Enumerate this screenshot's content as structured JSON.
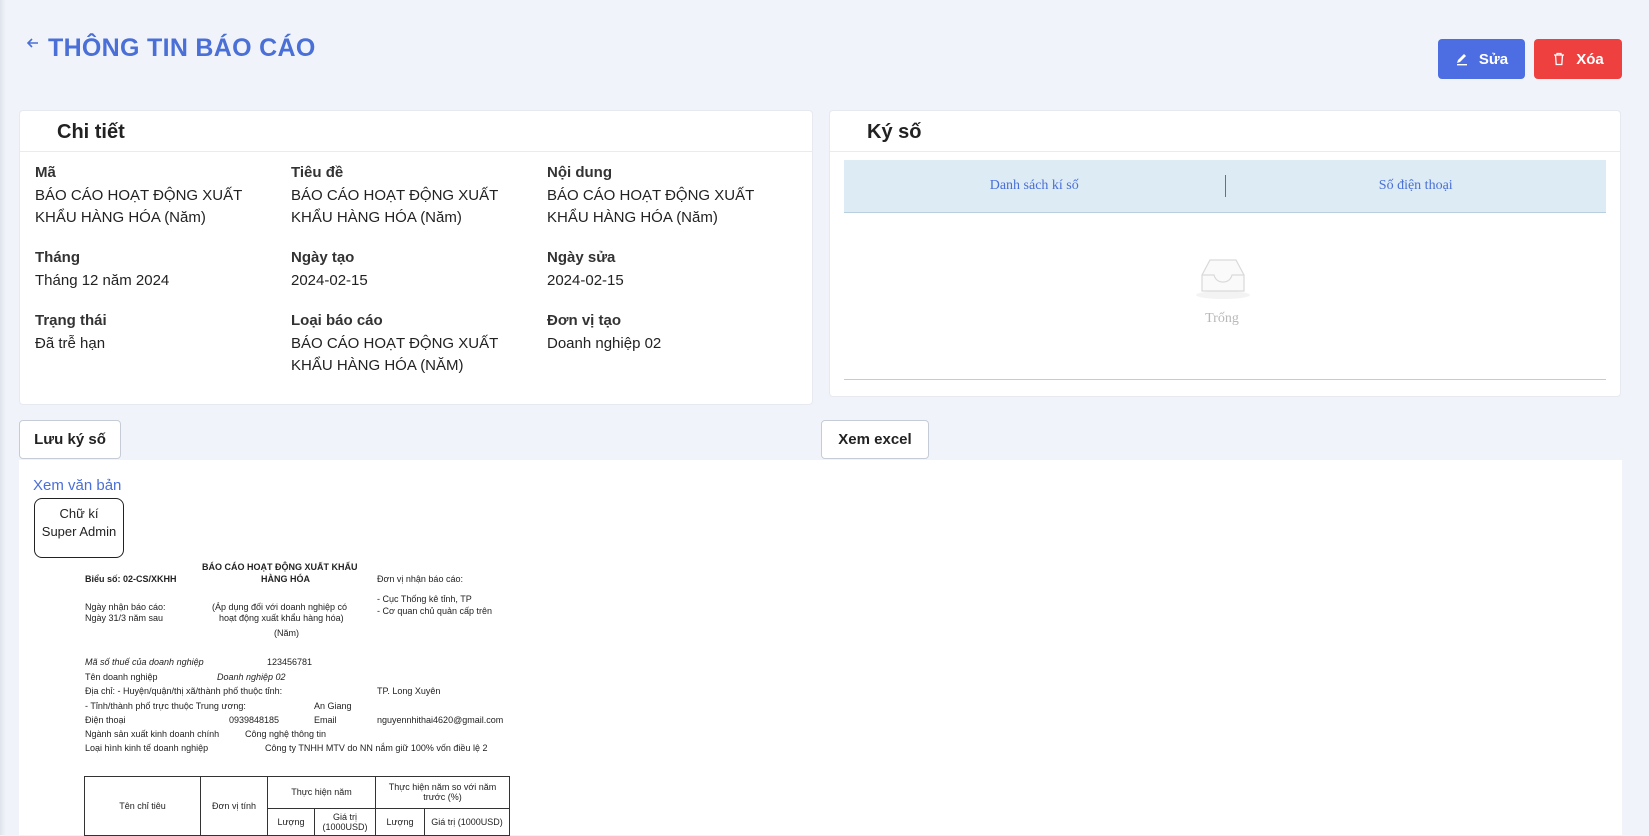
{
  "header": {
    "title": "THÔNG TIN BÁO CÁO",
    "back_icon": "arrow-left-icon"
  },
  "actions": {
    "edit_label": "Sửa",
    "delete_label": "Xóa",
    "edit_color": "#4d6ee3",
    "delete_color": "#ef4040"
  },
  "details": {
    "title": "Chi tiết",
    "fields": [
      {
        "label": "Mã",
        "value": "BÁO CÁO HOẠT ĐỘNG XUẤT KHẨU HÀNG HÓA (Năm)"
      },
      {
        "label": "Tiêu đề",
        "value": "BÁO CÁO HOẠT ĐỘNG XUẤT KHẨU HÀNG HÓA (Năm)"
      },
      {
        "label": "Nội dung",
        "value": "BÁO CÁO HOẠT ĐỘNG XUẤT KHẨU HÀNG HÓA (Năm)"
      },
      {
        "label": "Tháng",
        "value": "Tháng 12 năm 2024"
      },
      {
        "label": "Ngày tạo",
        "value": "2024-02-15"
      },
      {
        "label": "Ngày sửa",
        "value": "2024-02-15"
      },
      {
        "label": "Trạng thái",
        "value": "Đã trễ hạn"
      },
      {
        "label": "Loại báo cáo",
        "value": "BÁO CÁO HOẠT ĐỘNG XUẤT KHẨU HÀNG HÓA (NĂM)"
      },
      {
        "label": "Đơn vị tạo",
        "value": "Doanh nghiệp 02"
      }
    ]
  },
  "signing": {
    "title": "Ký số",
    "columns": [
      "Danh sách kí số",
      "Số điện thoại"
    ],
    "empty_text": "Trống"
  },
  "buttons": {
    "save_sign": "Lưu ký số",
    "view_excel": "Xem excel"
  },
  "document": {
    "view_link": "Xem văn bản",
    "signature": {
      "line1": "Chữ kí",
      "line2": "Super Admin"
    },
    "form_no": "Biểu số: 02-CS/XKHH",
    "doc_title_1": "BÁO CÁO HOẠT ĐỘNG XUẤT KHẨU",
    "doc_title_2": "HÀNG HÓA",
    "recv_unit_label": "Đơn vị nhận báo cáo:",
    "recv_unit_1": "- Cục Thống kê tỉnh, TP",
    "recv_unit_2": "- Cơ quan chủ quản cấp trên",
    "recv_date_label": "Ngày nhận báo cáo:",
    "recv_date_value": "Ngày 31/3 năm sau",
    "apply_1": "(Áp dụng đối với doanh nghiệp có",
    "apply_2": "hoạt động xuất khẩu hàng hóa)",
    "period": "(Năm)",
    "tax_label": "Mã số thuế của doanh nghiệp",
    "tax_value": "123456781",
    "company_label": "Tên doanh nghiệp",
    "company_value": "Doanh nghiệp 02",
    "addr_label": "Địa chỉ: - Huyện/quận/thị xã/thành phố thuộc tỉnh:",
    "addr_value": "TP. Long Xuyên",
    "province_label": "- Tỉnh/thành phố trực thuộc Trung ương:",
    "province_value": "An Giang",
    "phone_label": "Điện thoại",
    "phone_value": "0939848185",
    "email_label": "Email",
    "email_value": "nguyennhithai4620@gmail.com",
    "industry_label": "Ngành sản xuất kinh doanh chính",
    "industry_value": "Công nghệ thông tin",
    "type_label": "Loại hình kinh tế doanh nghiệp",
    "type_value": "Công ty TNHH MTV do NN nắm giữ 100% vốn điều lệ 2",
    "table": {
      "col_indicator": "Tên chỉ tiêu",
      "col_unit": "Đơn vị tính",
      "col_year": "Thực hiện năm",
      "col_compare_1": "Thực hiện năm so với năm",
      "col_compare_2": "trước (%)",
      "sub_qty": "Lượng",
      "sub_value_1": "Giá trị",
      "sub_value_2": "(1000USD)",
      "sub_qty_2": "Lượng",
      "sub_value_cmp": "Giá trị (1000USD)"
    }
  }
}
